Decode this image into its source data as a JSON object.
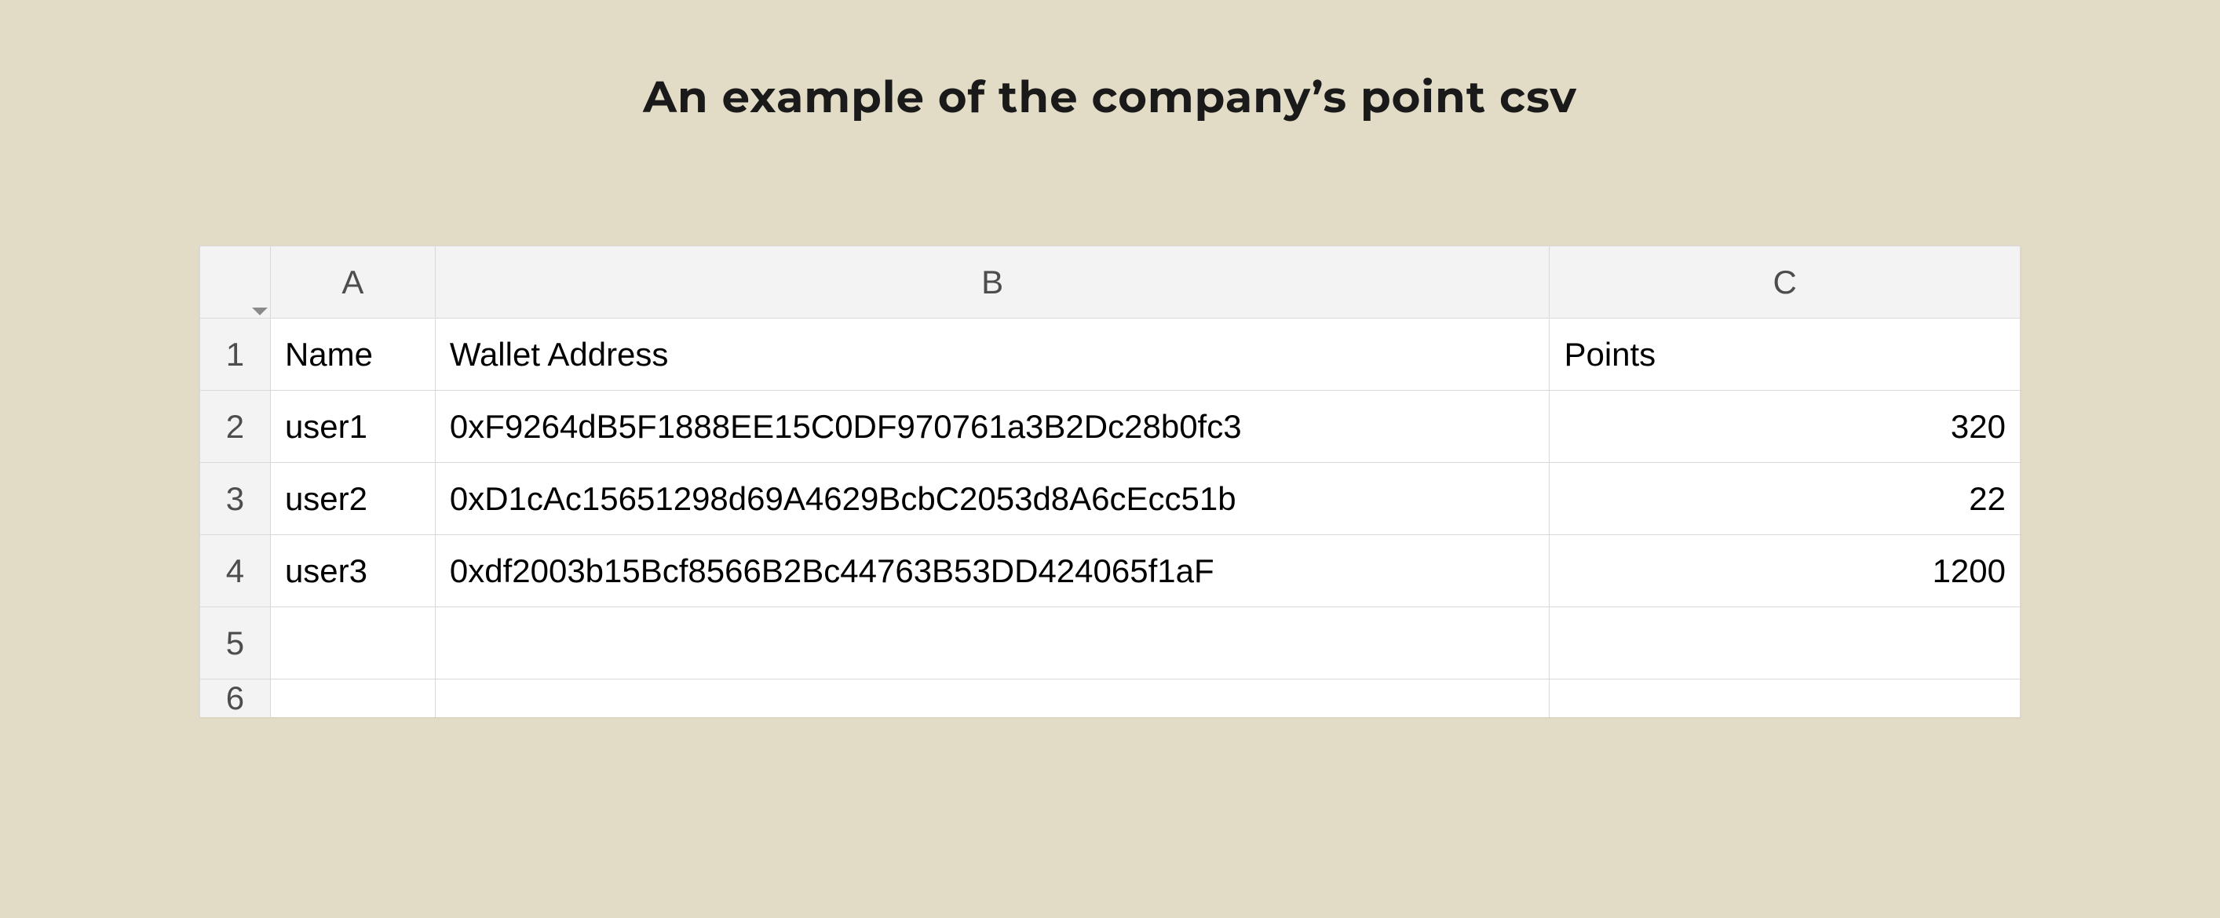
{
  "title": "An example of the company’s point csv",
  "columns": {
    "a": "A",
    "b": "B",
    "c": "C"
  },
  "rowNumbers": [
    "1",
    "2",
    "3",
    "4",
    "5",
    "6"
  ],
  "headerRow": {
    "name": "Name",
    "wallet": "Wallet Address",
    "points": "Points"
  },
  "rows": [
    {
      "name": "user1",
      "wallet": "0xF9264dB5F1888EE15C0DF970761a3B2Dc28b0fc3",
      "points": "320"
    },
    {
      "name": "user2",
      "wallet": "0xD1cAc15651298d69A4629BcbC2053d8A6cEcc51b",
      "points": "22"
    },
    {
      "name": "user3",
      "wallet": "0xdf2003b15Bcf8566B2Bc44763B53DD424065f1aF",
      "points": "1200"
    }
  ]
}
